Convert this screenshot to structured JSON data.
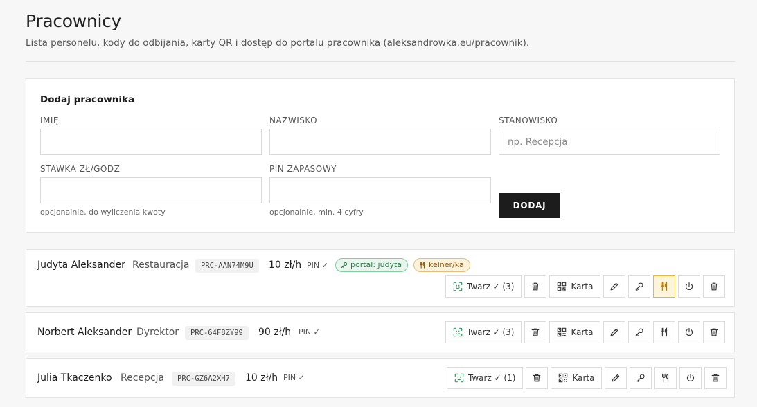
{
  "header": {
    "title": "Pracownicy",
    "subtitle": "Lista personelu, kody do odbijania, karty QR i dostęp do portalu pracownika (aleksandrowka.eu/pracownik)."
  },
  "form": {
    "title": "Dodaj pracownika",
    "first_name_label": "IMIĘ",
    "first_name_value": "",
    "last_name_label": "NAZWISKO",
    "last_name_value": "",
    "position_label": "STANOWISKO",
    "position_placeholder": "np. Recepcja",
    "rate_label": "STAWKA ZŁ/GODZ",
    "rate_hint": "opcjonalnie, do wyliczenia kwoty",
    "pin_label": "PIN ZAPASOWY",
    "pin_hint": "opcjonalnie, min. 4 cyfry",
    "add_label": "DODAJ"
  },
  "employees": [
    {
      "name": "Judyta Aleksander",
      "role": "Restauracja",
      "code": "PRC-AAN74M9U",
      "rate": "10 zł/h",
      "pin": "PIN ✓",
      "portal_badge": "portal: judyta",
      "kelner_badge": "kelner/ka",
      "face_label": "Twarz ✓ (3)",
      "card_label": "Karta",
      "waiter_active": true
    },
    {
      "name": "Norbert Aleksander",
      "role": "Dyrektor",
      "code": "PRC-64F8ZY99",
      "rate": "90 zł/h",
      "pin": "PIN ✓",
      "face_label": "Twarz ✓ (3)",
      "card_label": "Karta",
      "waiter_active": false
    },
    {
      "name": "Julia Tkaczenko",
      "role": "Recepcja",
      "code": "PRC-GZ6A2XH7",
      "rate": "10 zł/h",
      "pin": "PIN ✓",
      "face_label": "Twarz ✓ (1)",
      "card_label": "Karta",
      "waiter_active": false
    }
  ],
  "icons": {
    "face": "face-scan-icon",
    "delete": "trash-icon",
    "card": "qr-code-icon",
    "edit": "pencil-icon",
    "portal": "key-icon",
    "waiter": "fork-knife-icon",
    "deactivate": "power-icon"
  },
  "colors": {
    "accent_dark": "#1c1c1c",
    "portal_green": "#2a7a4a",
    "waiter_amber": "#8a5a10",
    "face_icon_green": "#2e9a5e"
  }
}
